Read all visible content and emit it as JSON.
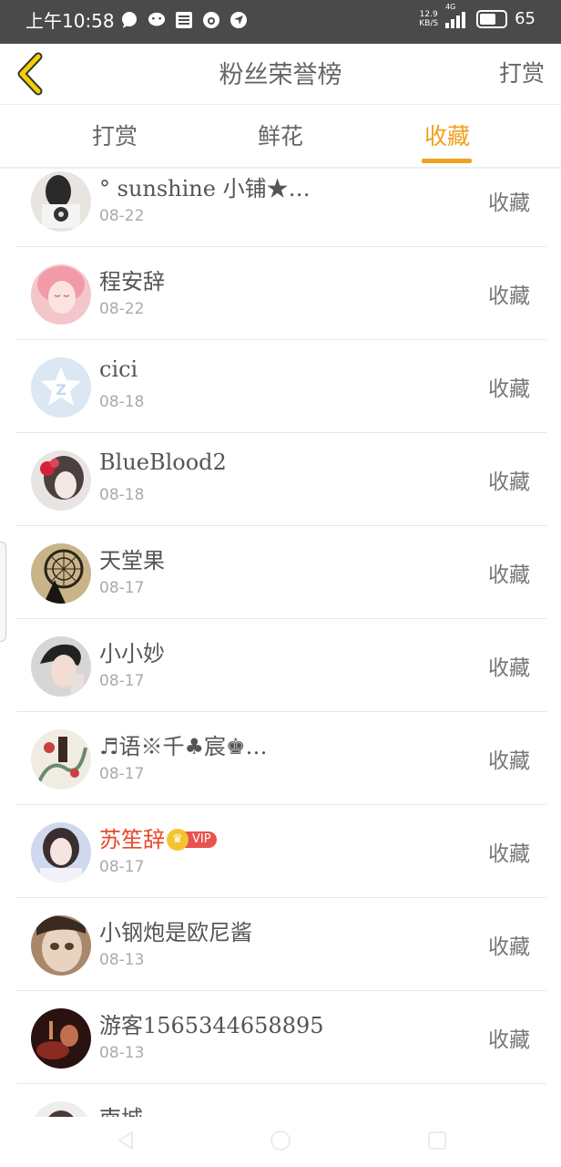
{
  "status_bar": {
    "time": "上午10:58",
    "icons": [
      "chat-bubble-icon",
      "wechat-icon",
      "list-app-icon",
      "clock-app-icon",
      "location-app-icon"
    ],
    "net_speed_value": "12.9",
    "net_speed_unit": "KB/S",
    "network": "4G",
    "battery": "65"
  },
  "header": {
    "title": "粉丝荣誉榜",
    "action": "打赏"
  },
  "tabs": [
    {
      "label": "打赏",
      "active": false
    },
    {
      "label": "鲜花",
      "active": false
    },
    {
      "label": "收藏",
      "active": true
    }
  ],
  "accent_color": "#f0a020",
  "fans": [
    {
      "name": "° sunshine 小铺★…",
      "date": "08-22",
      "action": "收藏"
    },
    {
      "name": "程安辞",
      "date": "08-22",
      "action": "收藏"
    },
    {
      "name": "cici",
      "date": "08-18",
      "action": "收藏"
    },
    {
      "name": "BlueBlood2",
      "date": "08-18",
      "action": "收藏"
    },
    {
      "name": "天堂果",
      "date": "08-17",
      "action": "收藏"
    },
    {
      "name": "小小妙",
      "date": "08-17",
      "action": "收藏"
    },
    {
      "name": "♬语※千♣宸♚…",
      "date": "08-17",
      "action": "收藏"
    },
    {
      "name": "苏笙辞",
      "date": "08-17",
      "action": "收藏",
      "vip": "VIP"
    },
    {
      "name": "小钢炮是欧尼酱",
      "date": "08-13",
      "action": "收藏"
    },
    {
      "name": "游客1565344658895",
      "date": "08-13",
      "action": "收藏"
    },
    {
      "name": "南城",
      "date": "",
      "action": ""
    }
  ]
}
